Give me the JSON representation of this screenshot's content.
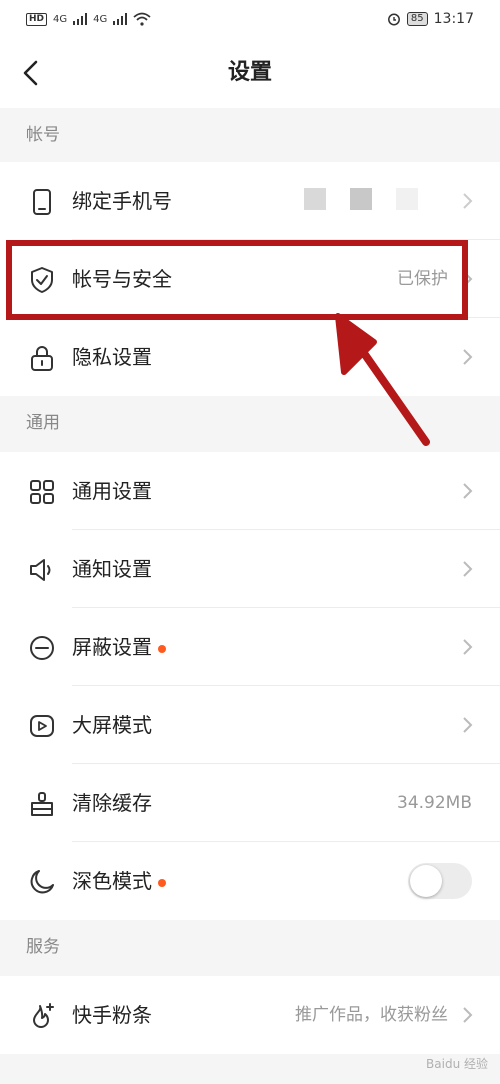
{
  "status_bar": {
    "hd": "HD",
    "network_1": "4G",
    "network_2": "4G",
    "battery": "85",
    "time": "13:17"
  },
  "header": {
    "title": "设置"
  },
  "sections": {
    "account": {
      "label": "帐号"
    },
    "general": {
      "label": "通用"
    },
    "services": {
      "label": "服务"
    }
  },
  "items": {
    "bind_phone": {
      "label": "绑定手机号"
    },
    "account_security": {
      "label": "帐号与安全",
      "value": "已保护"
    },
    "privacy": {
      "label": "隐私设置"
    },
    "general_settings": {
      "label": "通用设置"
    },
    "notifications": {
      "label": "通知设置"
    },
    "block_settings": {
      "label": "屏蔽设置"
    },
    "big_screen": {
      "label": "大屏模式"
    },
    "clear_cache": {
      "label": "清除缓存",
      "value": "34.92MB"
    },
    "dark_mode": {
      "label": "深色模式"
    },
    "kuaishou_fans": {
      "label": "快手粉条",
      "value": "推广作品，收获粉丝"
    }
  },
  "colors": {
    "accent_dot": "#ff5a1f",
    "highlight": "#b51818"
  },
  "watermark": "Baidu 经验"
}
